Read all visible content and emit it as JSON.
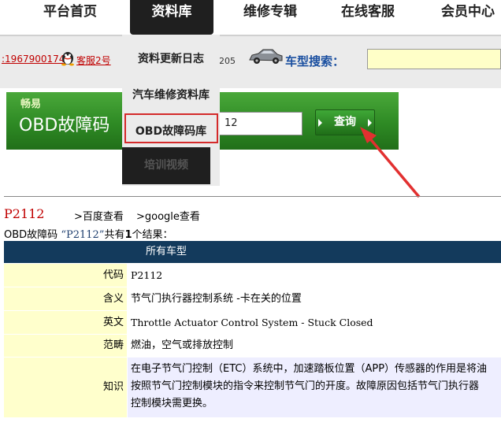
{
  "nav": {
    "items": [
      "平台首页",
      "资料库",
      "维修专辑",
      "在线客服",
      "会员中心"
    ]
  },
  "contact": {
    "qq_number": ":1967900174",
    "qq_label": "客服2号",
    "partial_text": "205",
    "car_search_label": "车型搜索："
  },
  "dropdown": {
    "items": [
      "资料更新日志",
      "汽车维修资料库",
      "OBD故障码库",
      "培训视频"
    ]
  },
  "banner": {
    "small_text": "畅易",
    "title": "OBD故障码",
    "search_value": "12",
    "query_button": "查询"
  },
  "result": {
    "code": "P2112",
    "baidu_link": ">百度查看",
    "google_link": ">google查看",
    "summary_prefix": "OBD故障码",
    "summary_query": "“P2112”",
    "summary_mid": "共有",
    "summary_count": "1",
    "summary_suffix": "个结果："
  },
  "table": {
    "header": "所有车型",
    "rows": [
      {
        "label": "代码",
        "value": "P2112"
      },
      {
        "label": "含义",
        "value": "节气门执行器控制系统 -卡在关的位置"
      },
      {
        "label": "英文",
        "value": "Throttle Actuator Control System - Stuck Closed"
      },
      {
        "label": "范畴",
        "value": "燃油，空气或排放控制"
      },
      {
        "label": "知识",
        "lines": [
          "在电子节气门控制（ETC）系统中，加速踏板位置（APP）传感器的作用是将油",
          "按照节气门控制模块的指令来控制节气门的开度。故障原因包括节气门执行器",
          "控制模块需更换。"
        ]
      }
    ]
  },
  "colors": {
    "accent_red": "#c00000",
    "table_header": "#133a5c",
    "label_bg": "#ffffcc",
    "banner_green": "#2e8a24",
    "highlight_border": "#d42a2a"
  }
}
